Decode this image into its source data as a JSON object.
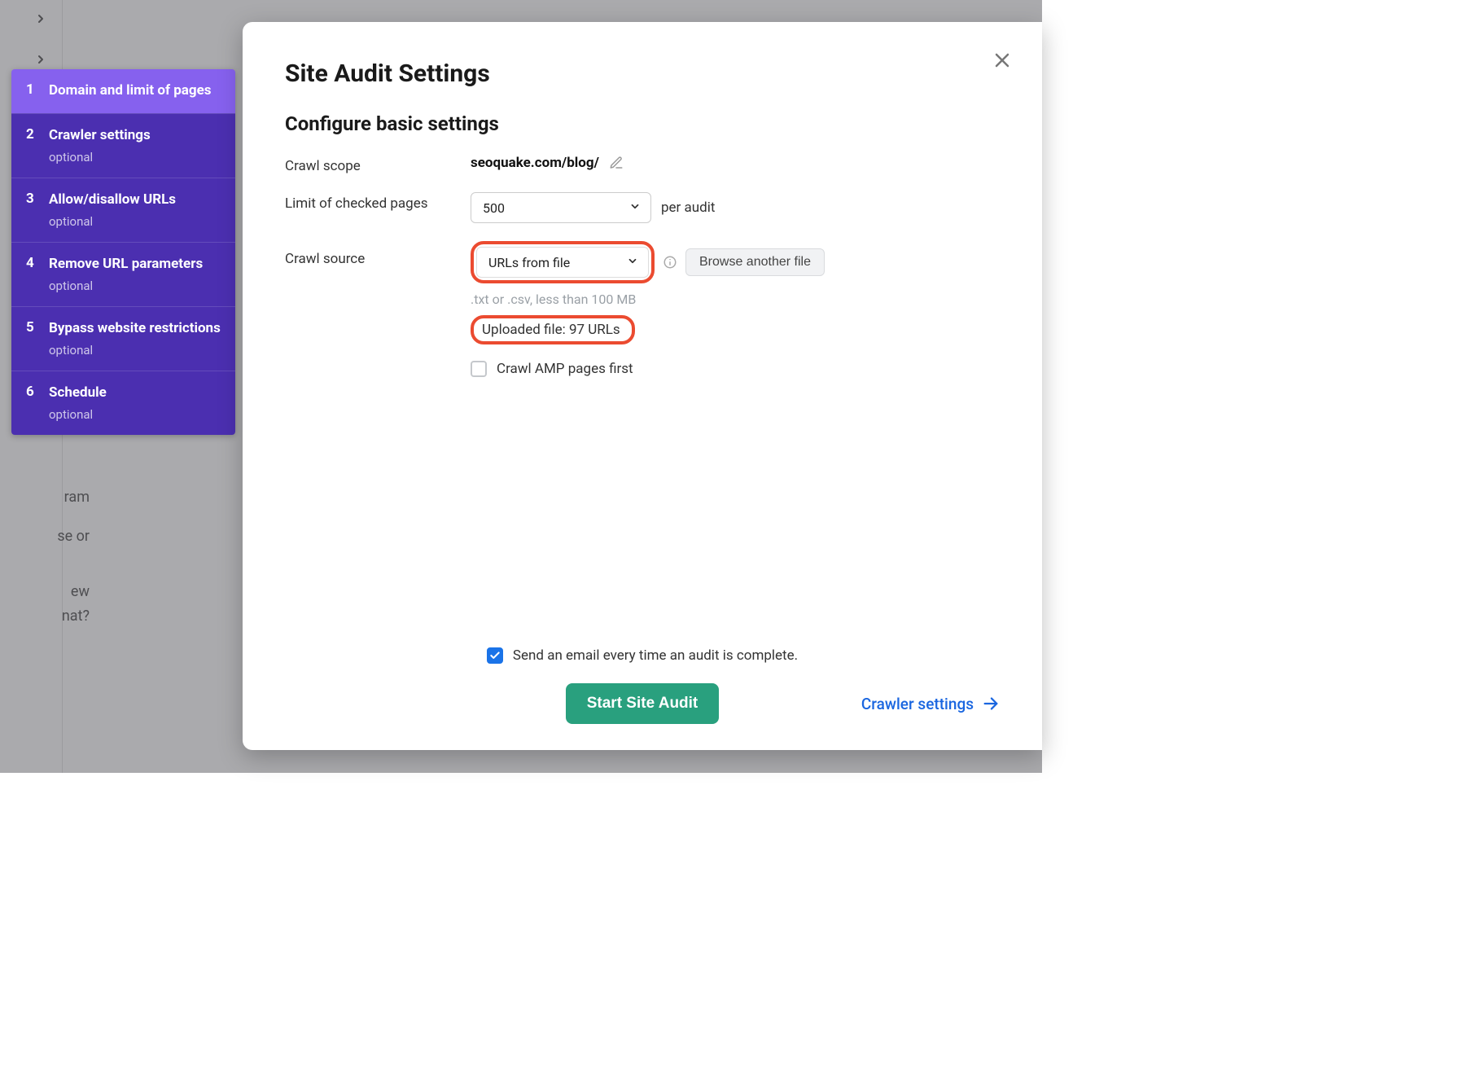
{
  "sidebar": {
    "steps": [
      {
        "num": "1",
        "title": "Domain and limit of pages",
        "optional": "",
        "active": true
      },
      {
        "num": "2",
        "title": "Crawler settings",
        "optional": "optional",
        "active": false
      },
      {
        "num": "3",
        "title": "Allow/disallow URLs",
        "optional": "optional",
        "active": false
      },
      {
        "num": "4",
        "title": "Remove URL parameters",
        "optional": "optional",
        "active": false
      },
      {
        "num": "5",
        "title": "Bypass website restrictions",
        "optional": "optional",
        "active": false
      },
      {
        "num": "6",
        "title": "Schedule",
        "optional": "optional",
        "active": false
      }
    ]
  },
  "modal": {
    "title": "Site Audit Settings",
    "subtitle": "Configure basic settings",
    "scope_label": "Crawl scope",
    "scope_value": "seoquake.com/blog/",
    "limit_label": "Limit of checked pages",
    "limit_value": "500",
    "limit_suffix": "per audit",
    "source_label": "Crawl source",
    "source_value": "URLs from file",
    "browse_label": "Browse another file",
    "hint": ".txt or .csv, less than 100 MB",
    "uploaded": "Uploaded file: 97 URLs",
    "amp_label": "Crawl AMP pages first",
    "email_label": "Send an email every time an audit is complete.",
    "primary_button": "Start Site Audit",
    "next_link": "Crawler settings"
  },
  "background": {
    "frag1": "ram",
    "frag2": "se or",
    "frag3": "ew",
    "frag4": "nat?"
  }
}
